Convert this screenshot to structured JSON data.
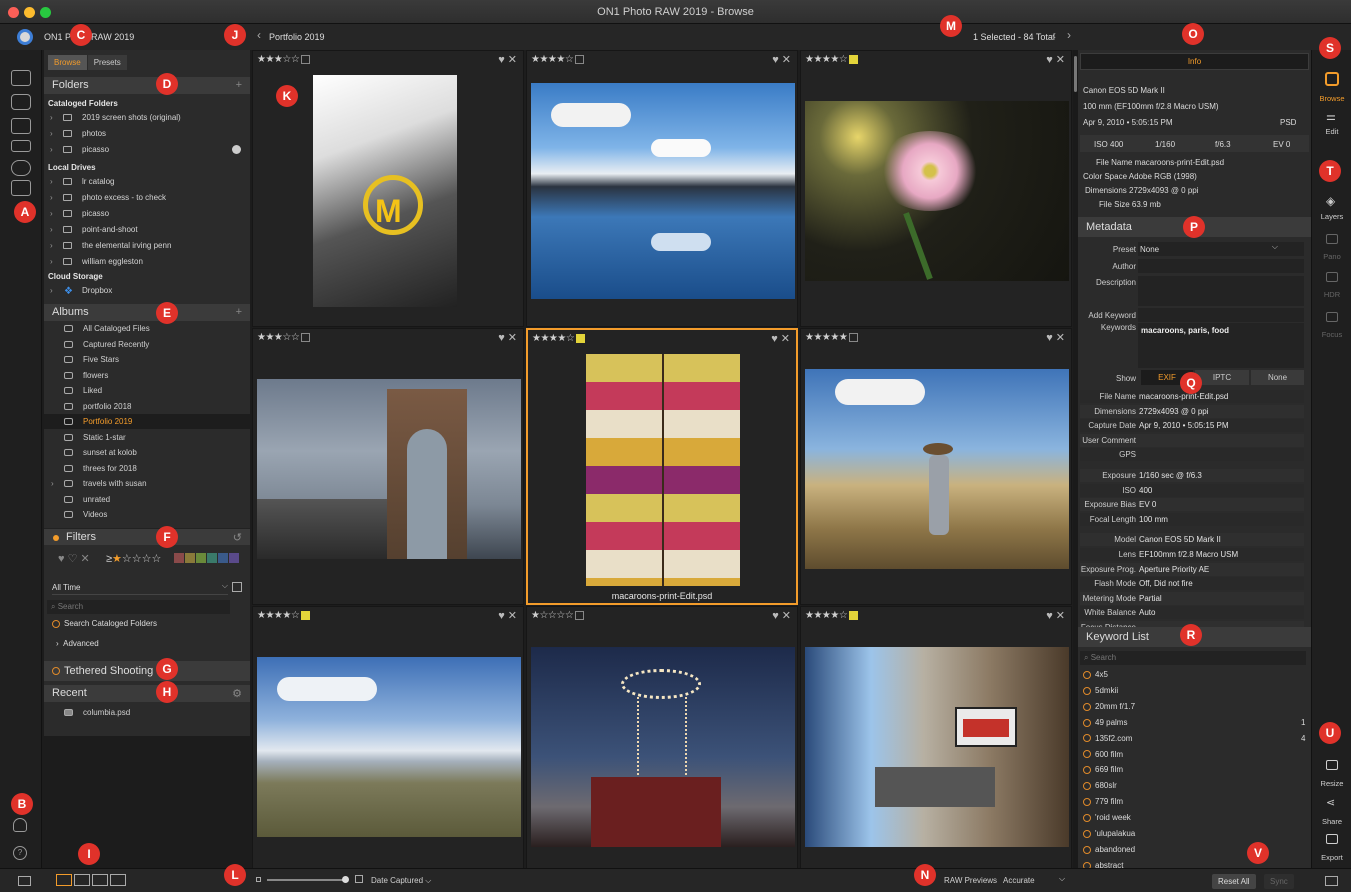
{
  "window": {
    "title": "ON1 Photo RAW 2019 - Browse",
    "app_name": "ON1 Photo RAW 2019"
  },
  "header": {
    "breadcrumb": "Portfolio 2019",
    "selection": "1 Selected - 84 Total"
  },
  "left_panel": {
    "tabs": [
      "Browse",
      "Presets"
    ],
    "folders": {
      "title": "Folders",
      "cataloged_title": "Cataloged Folders",
      "cataloged": [
        "2019 screen shots (original)",
        "photos",
        "picasso"
      ],
      "local_title": "Local Drives",
      "local": [
        "lr catalog",
        "photo excess - to check",
        "picasso",
        "point-and-shoot",
        "the elemental irving penn",
        "william eggleston"
      ],
      "cloud_title": "Cloud Storage",
      "cloud": [
        "Dropbox"
      ]
    },
    "albums": {
      "title": "Albums",
      "items": [
        "All Cataloged Files",
        "Captured Recently",
        "Five Stars",
        "flowers",
        "Liked",
        "portfolio 2018",
        "Portfolio 2019",
        "Static 1-star",
        "sunset at kolob",
        "threes for 2018",
        "travels with susan",
        "unrated",
        "Videos"
      ],
      "selected": "Portfolio 2019"
    },
    "filters": {
      "title": "Filters",
      "rating_symbol": "≥",
      "date_value": "All Time",
      "search_placeholder": "Search",
      "search_option": "Search Cataloged Folders",
      "advanced": "Advanced",
      "colors": [
        "#8a4a4a",
        "#8a7a3a",
        "#6a8a3a",
        "#3a7a6a",
        "#3a5a8a",
        "#5a4a8a"
      ]
    },
    "tethered": {
      "title": "Tethered Shooting"
    },
    "recent": {
      "title": "Recent",
      "items": [
        "columbia.psd"
      ]
    }
  },
  "grid": {
    "cells": [
      {
        "stars": "★★★☆☆",
        "color": "",
        "name": ""
      },
      {
        "stars": "★★★★☆",
        "color": "",
        "name": ""
      },
      {
        "stars": "★★★★☆",
        "color": "#e3d43a",
        "name": ""
      },
      {
        "stars": "★★★☆☆",
        "color": "",
        "name": ""
      },
      {
        "stars": "★★★★☆",
        "color": "#e3d43a",
        "name": "macaroons-print-Edit.psd"
      },
      {
        "stars": "★★★★★",
        "color": "",
        "name": ""
      },
      {
        "stars": "★★★★☆",
        "color": "#e3d43a",
        "name": ""
      },
      {
        "stars": "★☆☆☆☆",
        "color": "",
        "name": ""
      },
      {
        "stars": "★★★★☆",
        "color": "#e3d43a",
        "name": ""
      }
    ]
  },
  "info": {
    "tab": "Info",
    "camera": "Canon EOS 5D Mark II",
    "lens": "100 mm (EF100mm f/2.8 Macro USM)",
    "date": "Apr 9, 2010 • 5:05:15 PM",
    "format": "PSD",
    "iso": "ISO 400",
    "shutter": "1/160",
    "aperture": "f/6.3",
    "ev": "EV 0",
    "file_name": "File Name macaroons-print-Edit.psd",
    "color_space": "Color Space Adobe RGB (1998)",
    "dimensions": "Dimensions 2729x4093 @ 0 ppi",
    "file_size": "File Size 63.9 mb"
  },
  "metadata": {
    "title": "Metadata",
    "preset_label": "Preset",
    "preset_value": "None",
    "author_label": "Author",
    "description_label": "Description",
    "add_keyword_label": "Add Keyword",
    "keywords_label": "Keywords",
    "keywords_value": "macaroons, paris, food",
    "show_label": "Show",
    "show_options": [
      "EXIF",
      "IPTC",
      "None"
    ],
    "exif": [
      [
        "File Name",
        "macaroons-print-Edit.psd"
      ],
      [
        "Dimensions",
        "2729x4093 @ 0 ppi"
      ],
      [
        "Capture Date",
        "Apr 9, 2010 • 5:05:15 PM"
      ],
      [
        "User Comment",
        ""
      ],
      [
        "GPS",
        ""
      ],
      [
        "Exposure",
        "1/160 sec @ f/6.3"
      ],
      [
        "ISO",
        "400"
      ],
      [
        "Exposure Bias",
        "EV 0"
      ],
      [
        "Focal Length",
        "100 mm"
      ],
      [
        "Model",
        "Canon EOS 5D Mark II"
      ],
      [
        "Lens",
        "EF100mm f/2.8 Macro USM"
      ],
      [
        "Exposure Prog.",
        "Aperture Priority AE"
      ],
      [
        "Flash Mode",
        "Off, Did not fire"
      ],
      [
        "Metering Mode",
        "Partial"
      ],
      [
        "White Balance",
        "Auto"
      ],
      [
        "Focus Distance",
        ""
      ]
    ]
  },
  "keyword_list": {
    "title": "Keyword List",
    "search_placeholder": "Search",
    "items": [
      [
        "4x5",
        ""
      ],
      [
        "5dmkii",
        ""
      ],
      [
        "20mm f/1.7",
        ""
      ],
      [
        "49 palms",
        "1"
      ],
      [
        "135f2.com",
        "4"
      ],
      [
        "600 film",
        ""
      ],
      [
        "669 film",
        ""
      ],
      [
        "680slr",
        ""
      ],
      [
        "779 film",
        ""
      ],
      [
        "'roid week",
        ""
      ],
      [
        "'ulupalakua",
        ""
      ],
      [
        "abandoned",
        ""
      ],
      [
        "abstract",
        ""
      ]
    ]
  },
  "right_strip": {
    "browse": "Browse",
    "edit": "Edit",
    "layers": "Layers",
    "pano": "Pano",
    "hdr": "HDR",
    "focus": "Focus",
    "resize": "Resize",
    "share": "Share",
    "export": "Export"
  },
  "bottom": {
    "sort": "Date Captured",
    "raw_label": "RAW Previews",
    "raw_value": "Accurate",
    "reset": "Reset All",
    "sync": "Sync"
  },
  "badges": [
    "A",
    "B",
    "C",
    "D",
    "E",
    "F",
    "G",
    "H",
    "I",
    "J",
    "K",
    "L",
    "M",
    "N",
    "O",
    "P",
    "Q",
    "R",
    "S",
    "T",
    "U",
    "V"
  ]
}
